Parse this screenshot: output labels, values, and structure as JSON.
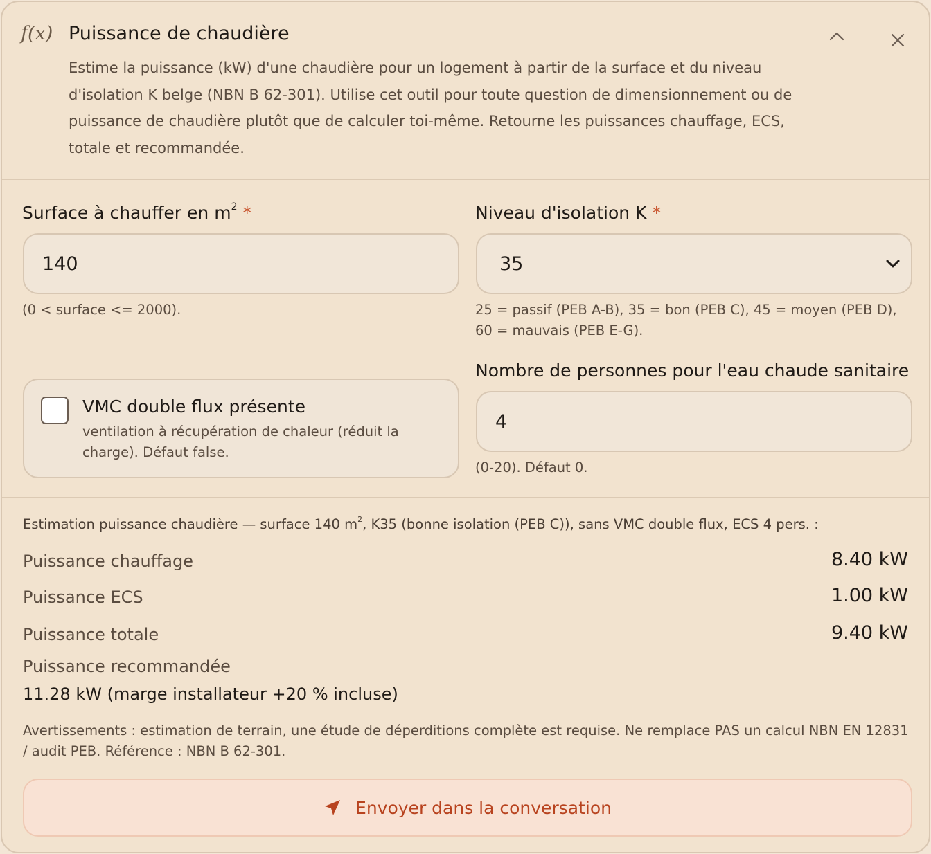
{
  "header": {
    "icon": "f(x)",
    "title": "Puissance de chaudière",
    "description": "Estime la puissance (kW) d'une chaudière pour un logement à partir de la surface et du niveau d'isolation K belge (NBN B 62-301). Utilise cet outil pour toute question de dimensionnement ou de puissance de chaudière plutôt que de calculer toi-même. Retourne les puissances chauffage, ECS, totale et recommandée."
  },
  "form": {
    "surface": {
      "label": "Surface à chauffer en m",
      "label_sup": "2",
      "required_mark": "*",
      "value": "140",
      "hint": "(0 < surface <= 2000)."
    },
    "isolation": {
      "label": "Niveau d'isolation K",
      "required_mark": "*",
      "selected": "35",
      "hint": "25 = passif (PEB A-B), 35 = bon (PEB C), 45 = moyen (PEB D), 60 = mauvais (PEB E-G)."
    },
    "vmc": {
      "label": "VMC double flux présente",
      "description": "ventilation à récupération de chaleur (réduit la charge). Défaut false.",
      "checked": false
    },
    "persons": {
      "label": "Nombre de personnes pour l'eau chaude sanitaire",
      "value": "4",
      "hint": "(0-20). Défaut 0."
    }
  },
  "result": {
    "summary_before": "Estimation puissance chaudière — surface 140 m",
    "summary_sup": "2",
    "summary_after": ", K35 (bonne isolation (PEB C)), sans VMC double flux, ECS 4 pers. :",
    "rows": [
      {
        "label": "Puissance chauffage",
        "value": "8.40 kW"
      },
      {
        "label": "Puissance ECS",
        "value": "1.00 kW"
      },
      {
        "label": "Puissance totale",
        "value": "9.40 kW"
      }
    ],
    "recommended_label": "Puissance recommandée",
    "recommended_value": "11.28 kW (marge installateur +20 % incluse)",
    "warning": "Avertissements : estimation de terrain, une étude de déperditions complète est requise. Ne remplace PAS un calcul NBN EN 12831 / audit PEB. Référence : NBN B 62-301."
  },
  "actions": {
    "send_label": "Envoyer dans la conversation"
  },
  "colors": {
    "accent": "#b8431f",
    "required": "#c9552f",
    "background": "#f2e3cf"
  }
}
